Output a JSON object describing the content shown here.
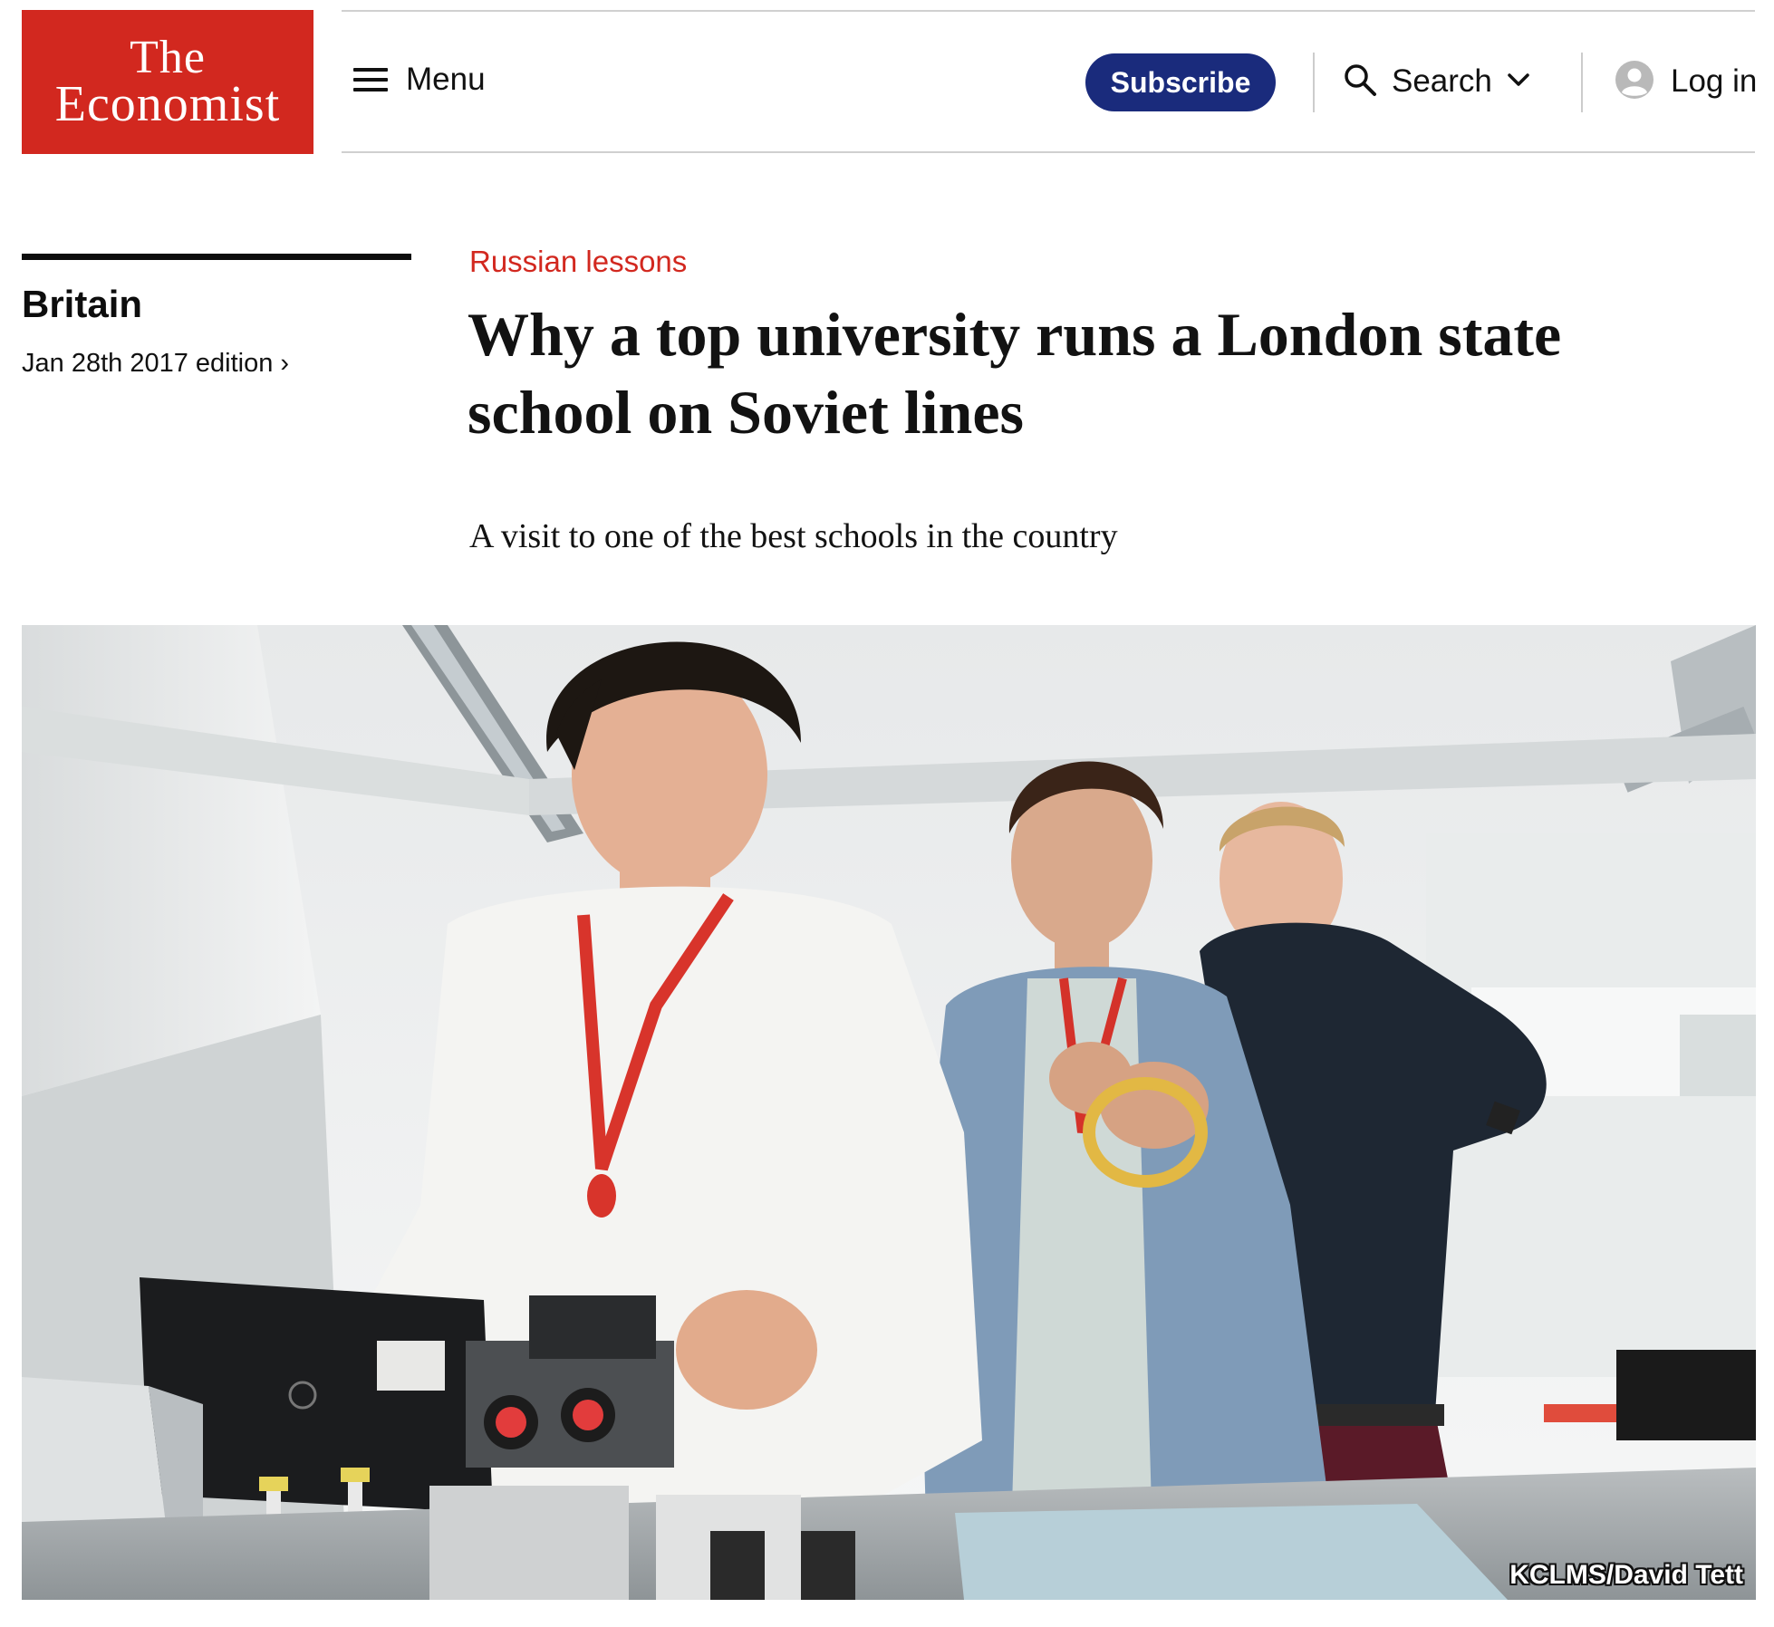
{
  "header": {
    "logo_line1": "The",
    "logo_line2": "Economist",
    "menu_label": "Menu",
    "subscribe_label": "Subscribe",
    "search_label": "Search",
    "login_label": "Log in",
    "brand_red": "#d2281f",
    "subscribe_blue": "#1a2b7c"
  },
  "article": {
    "section": "Britain",
    "edition": "Jan 28th 2017 edition",
    "edition_arrow": "›",
    "flytitle": "Russian lessons",
    "headline": "Why a top university runs a London state school on Soviet lines",
    "rubric": "A visit to one of the best schools in the country",
    "image_credit": "KCLMS/David Tett"
  },
  "icons": {
    "menu": "hamburger-icon",
    "search": "magnifier-icon",
    "search_toggle": "chevron-down-icon",
    "login": "user-avatar-icon"
  }
}
